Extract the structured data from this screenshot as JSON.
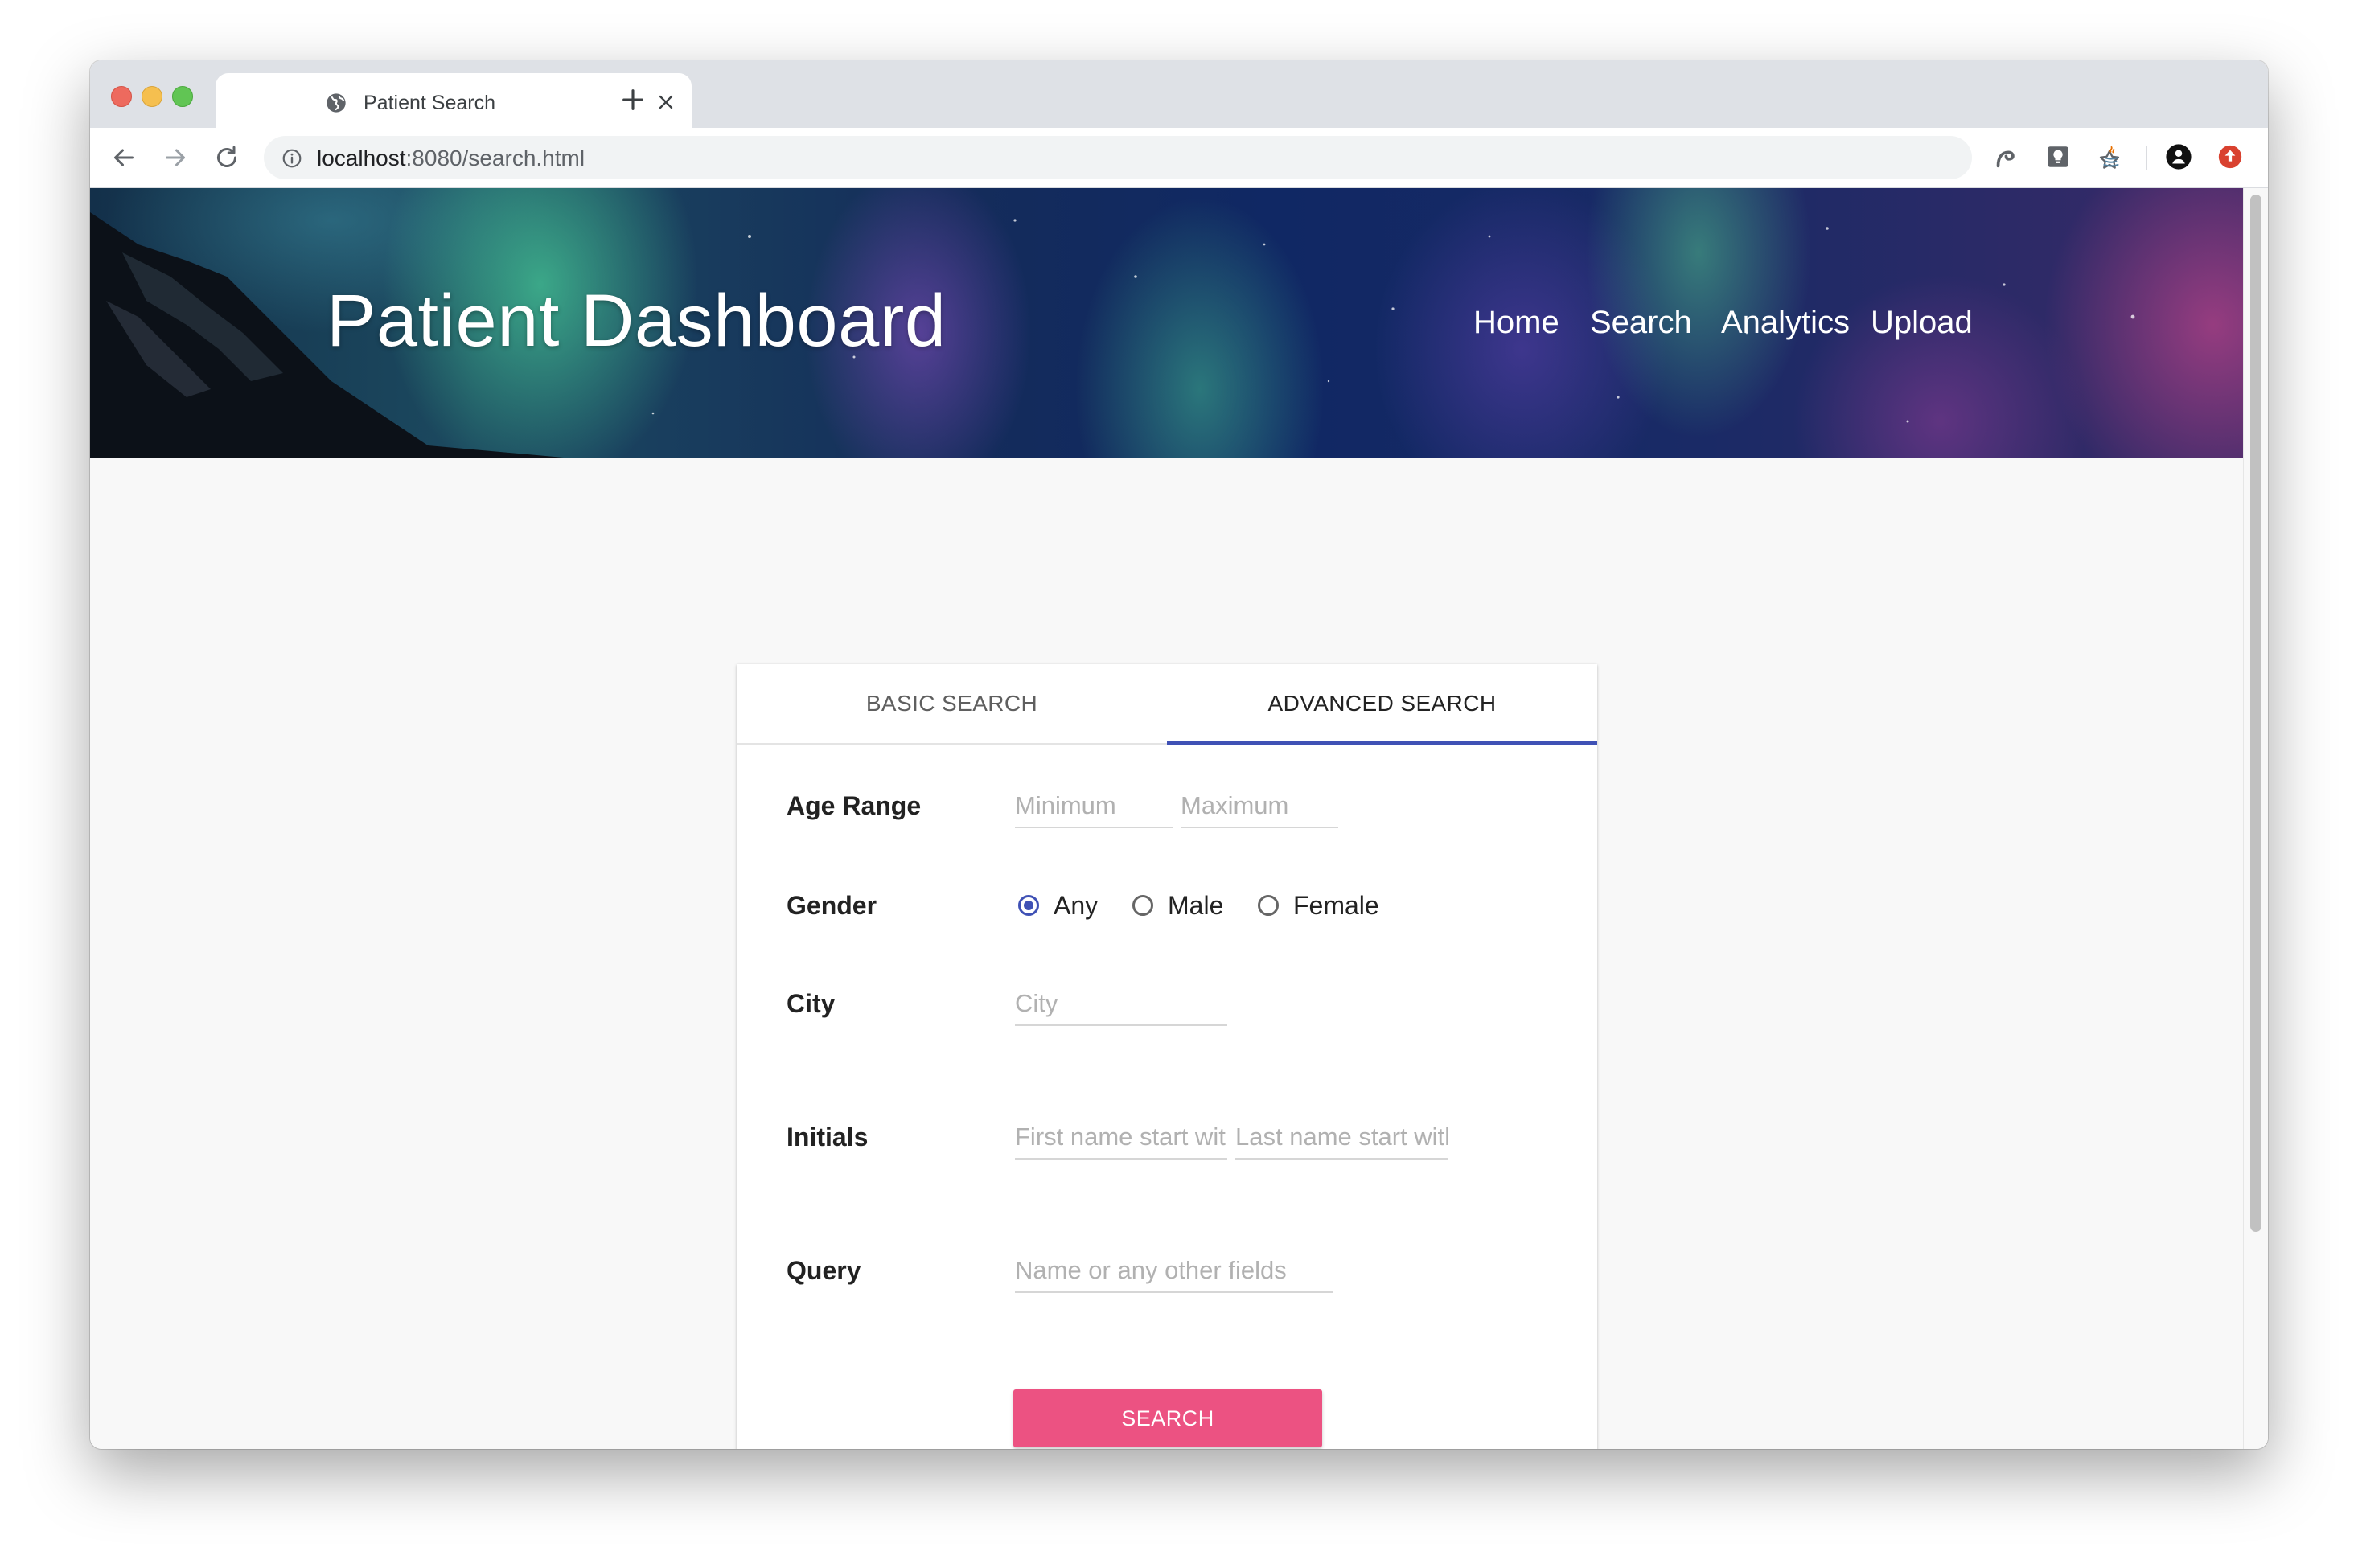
{
  "browser": {
    "tab_title": "Patient Search",
    "url_host": "localhost",
    "url_rest": ":8080/search.html"
  },
  "header": {
    "title": "Patient Dashboard",
    "nav": [
      "Home",
      "Search",
      "Analytics",
      "Upload"
    ]
  },
  "search_card": {
    "tabs": {
      "basic": "BASIC SEARCH",
      "advanced": "ADVANCED SEARCH",
      "active": "advanced"
    },
    "age_range": {
      "label": "Age Range",
      "min_placeholder": "Minimum",
      "max_placeholder": "Maximum"
    },
    "gender": {
      "label": "Gender",
      "options": [
        "Any",
        "Male",
        "Female"
      ],
      "selected": "Any"
    },
    "city": {
      "label": "City",
      "placeholder": "City"
    },
    "initials": {
      "label": "Initials",
      "first_placeholder": "First name start with",
      "last_placeholder": "Last name start with"
    },
    "query": {
      "label": "Query",
      "placeholder": "Name or any other fields"
    },
    "submit_label": "SEARCH"
  },
  "colors": {
    "accent": "#3f51b5",
    "button": "#ec5282"
  },
  "icons": {
    "favicon": "globe-icon",
    "close": "close-icon",
    "new_tab": "plus-icon",
    "back": "arrow-left-icon",
    "forward": "arrow-right-icon",
    "reload": "reload-icon",
    "site_info": "info-icon",
    "bookmark": "star-icon"
  }
}
